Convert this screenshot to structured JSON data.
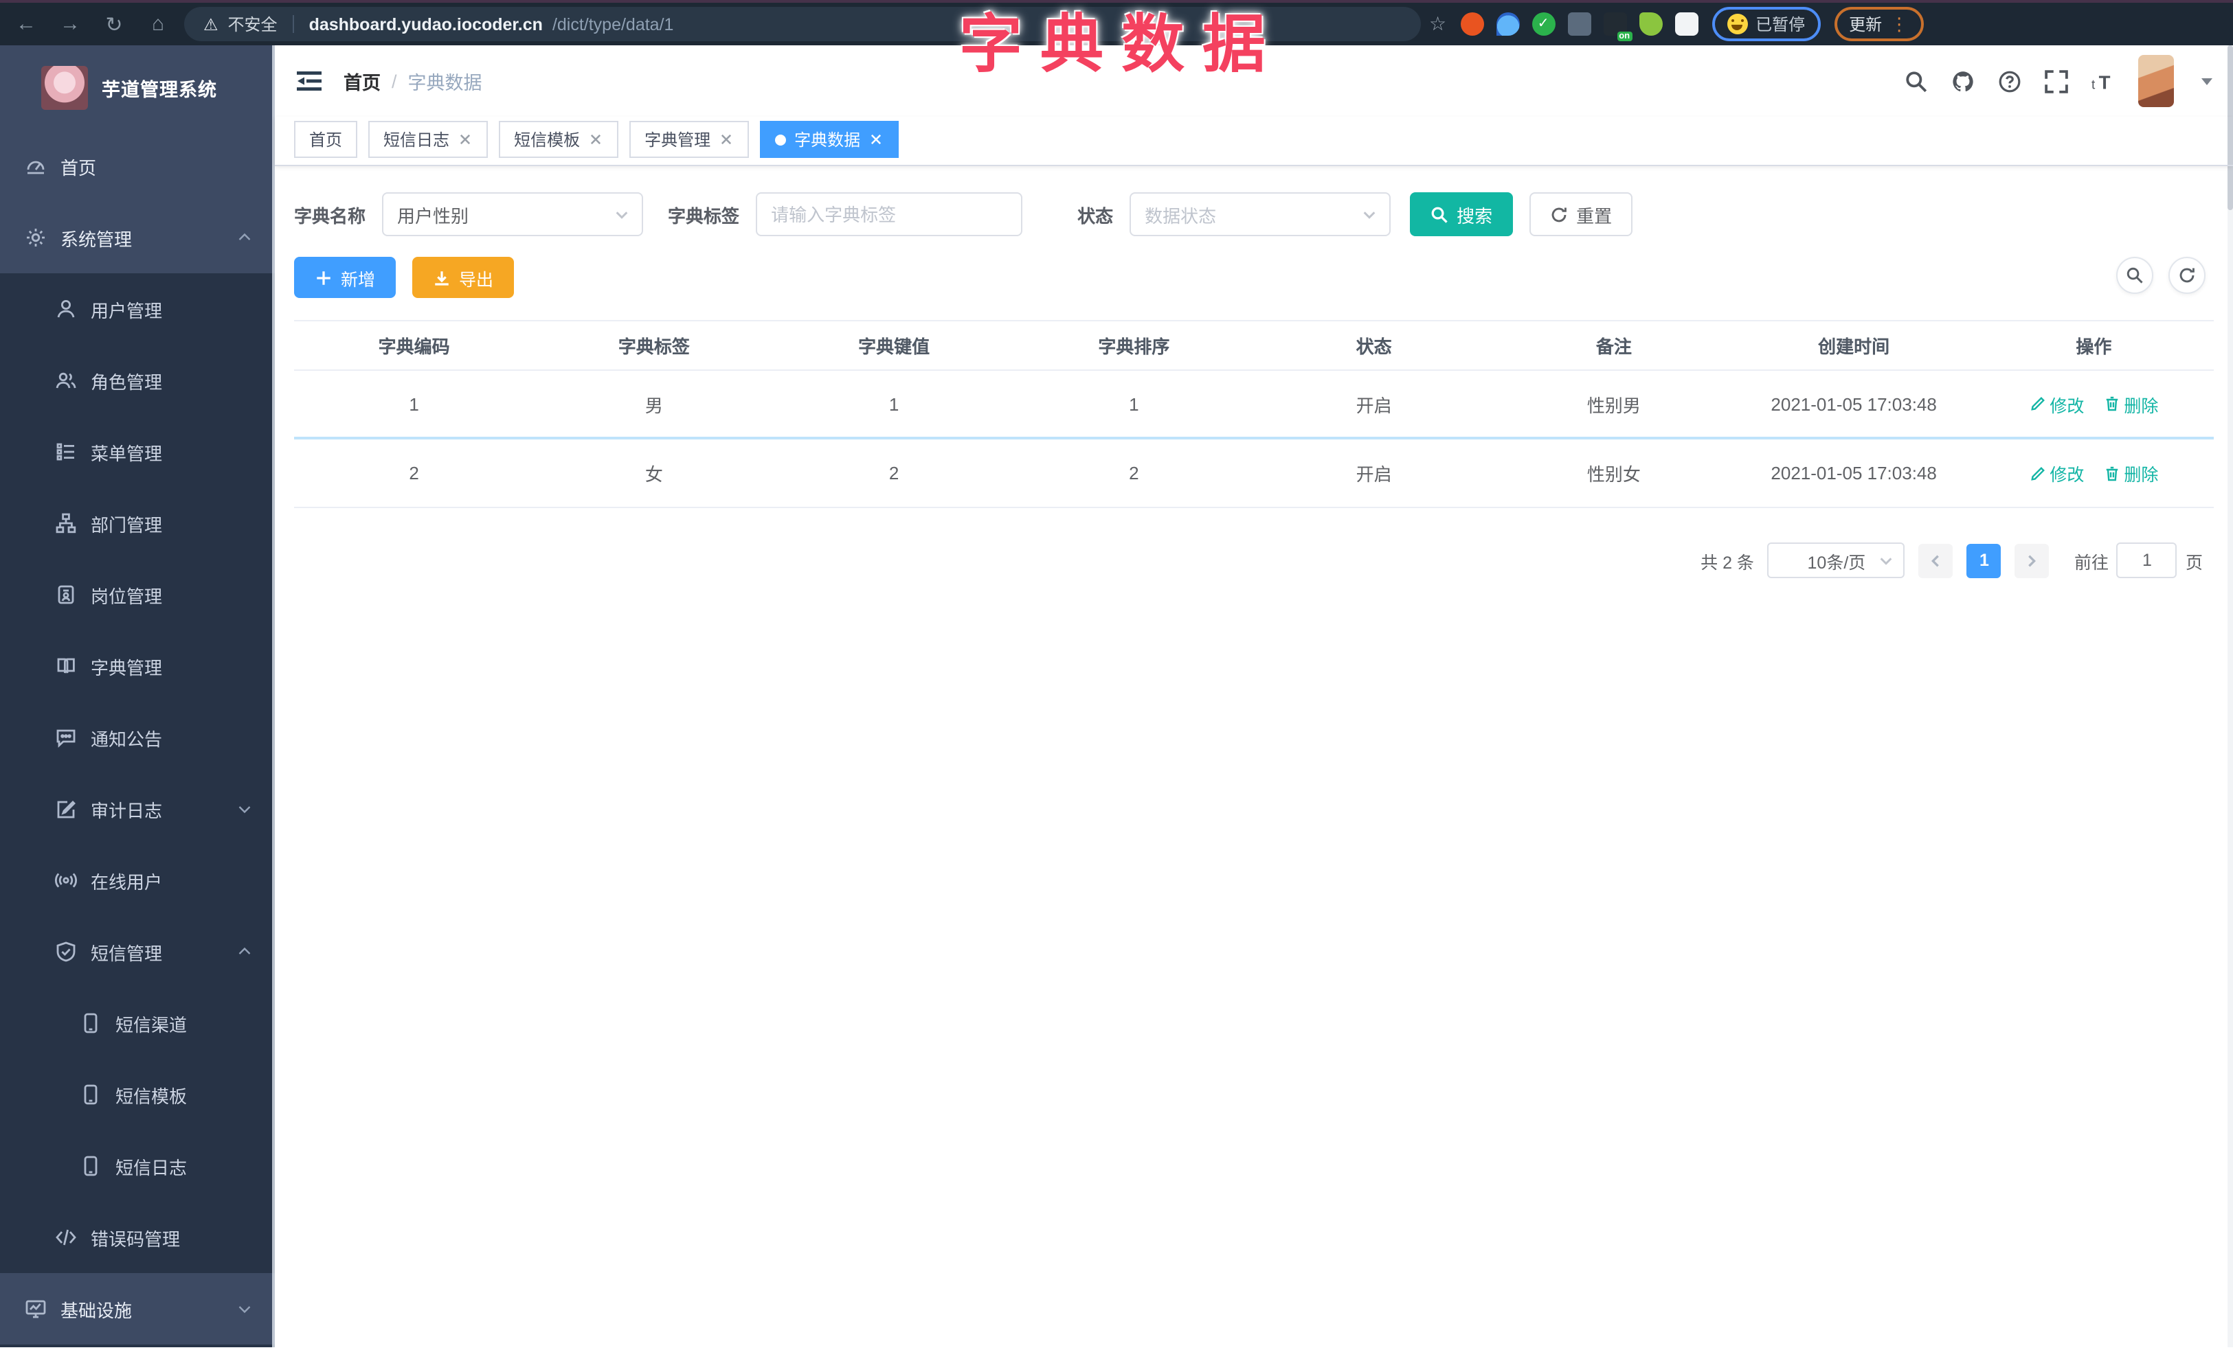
{
  "browser": {
    "security_label": "不安全",
    "url_domain": "dashboard.yudao.iocoder.cn",
    "url_path": "/dict/type/data/1",
    "extension_on_badge": "on",
    "paused_label": "已暂停",
    "update_label": "更新"
  },
  "annotation": {
    "title": "字典数据",
    "color": "#f4415f"
  },
  "sidebar": {
    "logo_title": "芋道管理系统",
    "items": [
      {
        "key": "home",
        "label": "首页",
        "icon": "dashboard-icon",
        "level": 1
      },
      {
        "key": "system-mgmt",
        "label": "系统管理",
        "icon": "gear-icon",
        "level": 1,
        "chevron": "up"
      },
      {
        "key": "user-mgmt",
        "label": "用户管理",
        "icon": "user-icon",
        "level": 2
      },
      {
        "key": "role-mgmt",
        "label": "角色管理",
        "icon": "users-icon",
        "level": 2
      },
      {
        "key": "menu-mgmt",
        "label": "菜单管理",
        "icon": "menu-list-icon",
        "level": 2
      },
      {
        "key": "dept-mgmt",
        "label": "部门管理",
        "icon": "org-tree-icon",
        "level": 2
      },
      {
        "key": "post-mgmt",
        "label": "岗位管理",
        "icon": "id-badge-icon",
        "level": 2
      },
      {
        "key": "dict-mgmt",
        "label": "字典管理",
        "icon": "book-icon",
        "level": 2
      },
      {
        "key": "notice",
        "label": "通知公告",
        "icon": "comment-icon",
        "level": 2
      },
      {
        "key": "audit-log",
        "label": "审计日志",
        "icon": "edit-log-icon",
        "level": 2,
        "chevron": "down"
      },
      {
        "key": "online-users",
        "label": "在线用户",
        "icon": "online-icon",
        "level": 2
      },
      {
        "key": "sms-mgmt",
        "label": "短信管理",
        "icon": "shield-check-icon",
        "level": 2,
        "chevron": "up"
      },
      {
        "key": "sms-channel",
        "label": "短信渠道",
        "icon": "phone-icon",
        "level": 3
      },
      {
        "key": "sms-template",
        "label": "短信模板",
        "icon": "phone-icon",
        "level": 3
      },
      {
        "key": "sms-log",
        "label": "短信日志",
        "icon": "phone-icon",
        "level": 3
      },
      {
        "key": "error-code-mgmt",
        "label": "错误码管理",
        "icon": "code-icon",
        "level": 2
      },
      {
        "key": "infrastructure",
        "label": "基础设施",
        "icon": "monitor-icon",
        "level": 1,
        "chevron": "down"
      }
    ]
  },
  "navbar": {
    "breadcrumb_home": "首页",
    "breadcrumb_separator": "/",
    "breadcrumb_current": "字典数据"
  },
  "tabs": [
    {
      "key": "home",
      "label": "首页",
      "closable": false,
      "active": false
    },
    {
      "key": "sms-log",
      "label": "短信日志",
      "closable": true,
      "active": false
    },
    {
      "key": "sms-template",
      "label": "短信模板",
      "closable": true,
      "active": false
    },
    {
      "key": "dict-mgmt",
      "label": "字典管理",
      "closable": true,
      "active": false
    },
    {
      "key": "dict-data",
      "label": "字典数据",
      "closable": true,
      "active": true
    }
  ],
  "filters": {
    "dict_name_label": "字典名称",
    "dict_name_value": "用户性别",
    "dict_label_label": "字典标签",
    "dict_label_placeholder": "请输入字典标签",
    "status_label": "状态",
    "status_placeholder": "数据状态",
    "search_label": "搜索",
    "reset_label": "重置"
  },
  "toolbar": {
    "add_label": "新增",
    "export_label": "导出"
  },
  "table": {
    "headers": [
      "字典编码",
      "字典标签",
      "字典键值",
      "字典排序",
      "状态",
      "备注",
      "创建时间",
      "操作"
    ],
    "rows": [
      {
        "code": "1",
        "label": "男",
        "value": "1",
        "sort": "1",
        "status": "开启",
        "remark": "性别男",
        "created": "2021-01-05 17:03:48"
      },
      {
        "code": "2",
        "label": "女",
        "value": "2",
        "sort": "2",
        "status": "开启",
        "remark": "性别女",
        "created": "2021-01-05 17:03:48"
      }
    ],
    "edit_label": "修改",
    "delete_label": "删除"
  },
  "pagination": {
    "total_label": "共 2 条",
    "page_size_label": "10条/页",
    "current_page": "1",
    "goto_label": "前往",
    "goto_value": "1",
    "page_unit_label": "页"
  },
  "colors": {
    "primary_blue": "#409eff",
    "theme_teal": "#12b7a3",
    "export_orange": "#f6a723",
    "annotation_red": "#f4415f",
    "sidebar_bg": "#273346",
    "sidebar_section_bg": "#3d4a63",
    "browser_bar_bg": "#1d2834"
  }
}
